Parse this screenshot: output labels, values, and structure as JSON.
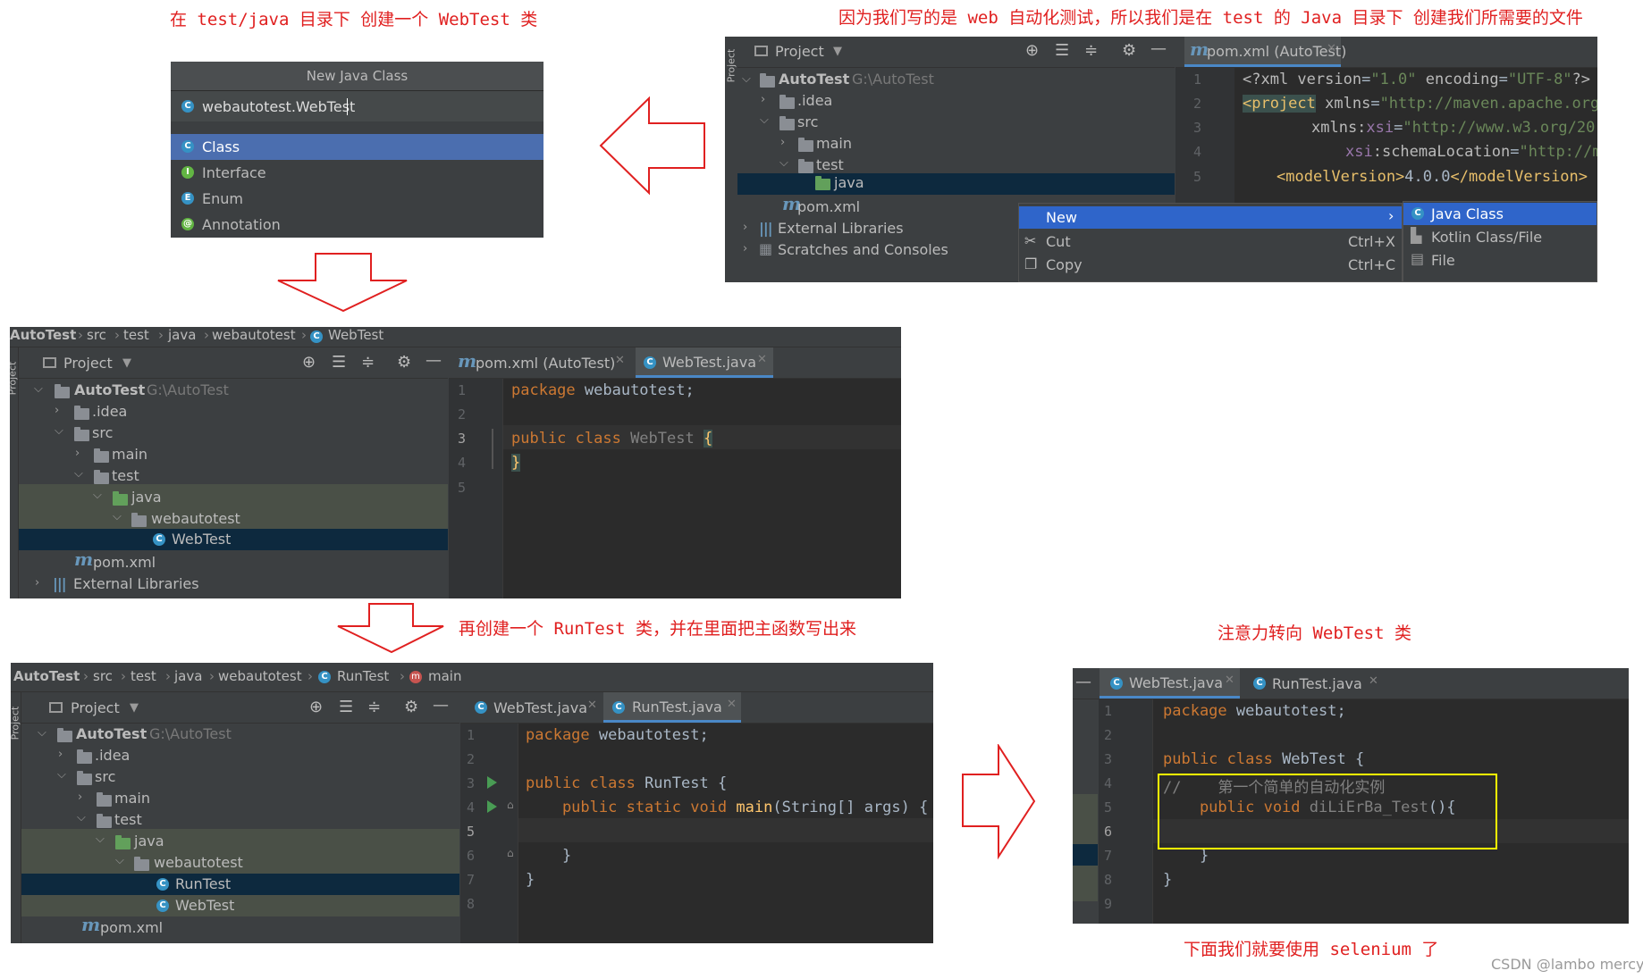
{
  "annotations": {
    "a1": "在 test/java 目录下 创建一个 WebTest 类",
    "a2": "因为我们写的是 web 自动化测试，所以我们是在 test 的 Java 目录下 创建我们所需要的文件",
    "a3": "再创建一个 RunTest 类，并在里面把主函数写出来",
    "a4": "注意力转向 WebTest 类",
    "a5": "下面我们就要使用 selenium 了"
  },
  "watermark": "CSDN @lambo mercy",
  "colors": {
    "annotation": "#e02020",
    "ide_bg": "#2b2b2b",
    "selection": "#0d293e",
    "menu_highlight": "#2f65ca",
    "highlight_box": "#ffff00"
  },
  "dialog": {
    "title": "New Java Class",
    "input_value": "webautotest.WebTest",
    "options": [
      {
        "icon": "C",
        "label": "Class"
      },
      {
        "icon": "I",
        "label": "Interface"
      },
      {
        "icon": "E",
        "label": "Enum"
      },
      {
        "icon": "@",
        "label": "Annotation"
      }
    ]
  },
  "ide_tr": {
    "side_tab": "Project",
    "project_label": "Project",
    "tab_label": "pom.xml (AutoTest)",
    "tree": {
      "root": "AutoTest",
      "root_path": "G:\\AutoTest",
      "idea": ".idea",
      "src": "src",
      "main": "main",
      "test": "test",
      "java": "java",
      "pom": "pom.xml",
      "ext": "External Libraries",
      "scratch": "Scratches and Consoles"
    },
    "line_numbers": [
      "1",
      "2",
      "3",
      "4",
      "5"
    ],
    "xml": {
      "l1a": "<?xml ",
      "l1b": "version",
      "l1c": "=",
      "l1d": "\"1.0\"",
      "l1e": " encoding",
      "l1f": "=",
      "l1g": "\"UTF-8\"",
      "l1h": "?>",
      "l2a": "<project",
      "l2b": " xmlns",
      "l2c": "=",
      "l2d": "\"http://maven.apache.org/",
      "l3a": "xmlns:",
      "l3b": "xsi",
      "l3c": "=",
      "l3d": "\"http://www.w3.org/20",
      "l4a": "xsi",
      "l4b": ":schemaLocation",
      "l4c": "=",
      "l4d": "\"http://mave",
      "l5a": "<modelVersion>",
      "l5b": "4.0.0",
      "l5c": "</modelVersion>"
    },
    "context_menu": [
      {
        "label": "New",
        "shortcut": ""
      },
      {
        "label": "Cut",
        "shortcut": "Ctrl+X"
      },
      {
        "label": "Copy",
        "shortcut": "Ctrl+C"
      }
    ],
    "submenu": [
      "Java Class",
      "Kotlin Class/File",
      "File"
    ]
  },
  "ide_ml": {
    "breadcrumb": [
      "AutoTest",
      "src",
      "test",
      "java",
      "webautotest",
      "WebTest"
    ],
    "project_label": "Project",
    "side_tab": "Project",
    "tabs": [
      "pom.xml (AutoTest)",
      "WebTest.java"
    ],
    "tree": {
      "root": "AutoTest",
      "root_path": "G:\\AutoTest",
      "idea": ".idea",
      "src": "src",
      "main": "main",
      "test": "test",
      "java": "java",
      "pkg": "webautotest",
      "cls": "WebTest",
      "pom": "pom.xml",
      "ext": "External Libraries"
    },
    "line_numbers": [
      "1",
      "2",
      "3",
      "4",
      "5"
    ],
    "code": {
      "l1a": "package",
      "l1b": " webautotest;",
      "l3a": "public class",
      "l3b": " WebTest ",
      "l3c": "{",
      "l4": "}"
    }
  },
  "ide_bl": {
    "breadcrumb": [
      "AutoTest",
      "src",
      "test",
      "java",
      "webautotest",
      "RunTest",
      "main"
    ],
    "project_label": "Project",
    "side_tab": "Project",
    "tabs": [
      "WebTest.java",
      "RunTest.java"
    ],
    "tree": {
      "root": "AutoTest",
      "root_path": "G:\\AutoTest",
      "idea": ".idea",
      "src": "src",
      "main": "main",
      "test": "test",
      "java": "java",
      "pkg": "webautotest",
      "run": "RunTest",
      "web": "WebTest",
      "pom": "pom.xml"
    },
    "line_numbers": [
      "1",
      "2",
      "3",
      "4",
      "5",
      "6",
      "7",
      "8"
    ],
    "code": {
      "l1a": "package",
      "l1b": " webautotest;",
      "l3a": "public class",
      "l3b": " RunTest {",
      "l4a": "    public static void ",
      "l4b": "main",
      "l4c": "(String[] args) {",
      "l6": "    }",
      "l7": "}"
    }
  },
  "ide_br": {
    "tabs": [
      "WebTest.java",
      "RunTest.java"
    ],
    "line_numbers": [
      "1",
      "2",
      "3",
      "4",
      "5",
      "6",
      "7",
      "8",
      "9"
    ],
    "code": {
      "l1a": "package",
      "l1b": " webautotest;",
      "l3a": "public class",
      "l3b": " WebTest {",
      "l4a": "//    ",
      "l4b": "第一个简单的自动化实例",
      "l5a": "    public void ",
      "l5b": "diLiErBa_Test",
      "l5c": "(){",
      "l7": "    }",
      "l8": "}"
    }
  }
}
